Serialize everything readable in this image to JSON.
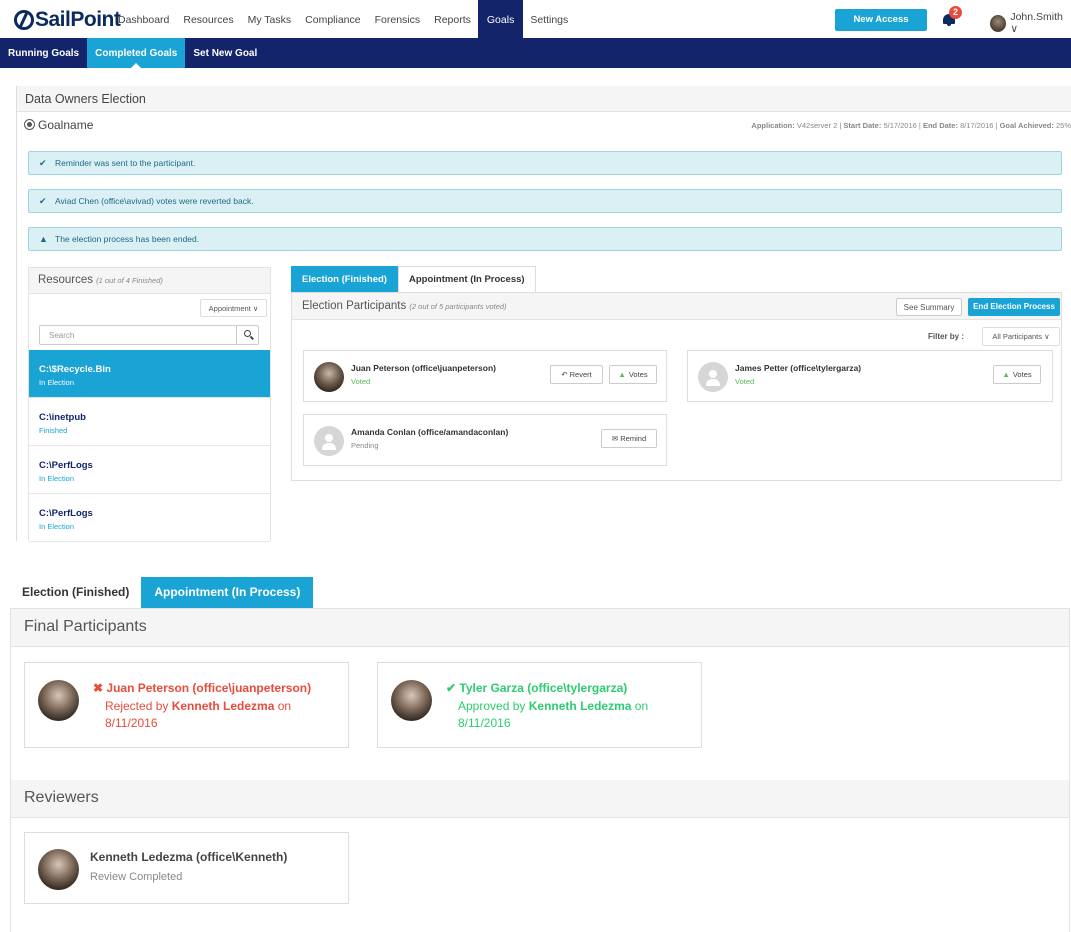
{
  "header": {
    "logo": "SailPoint",
    "nav": [
      "Dashboard",
      "Resources",
      "My Tasks",
      "Compliance",
      "Forensics",
      "Reports",
      "Goals",
      "Settings"
    ],
    "active_nav": "Goals",
    "new_request": "New Access Request",
    "notif_count": "2",
    "user": "John.Smith ∨"
  },
  "subnav": [
    "Running Goals",
    "Completed Goals",
    "Set New Goal"
  ],
  "page": {
    "title": "Data Owners Election",
    "goal_name": "Goalname",
    "meta": {
      "app_label": "Application:",
      "app": "V42server 2",
      "start_label": "Start Date:",
      "start": "5/17/2016",
      "end_label": "End Date:",
      "end": "8/17/2016",
      "achieved_label": "Goal Achieved:",
      "achieved": "25%"
    }
  },
  "alerts": [
    {
      "icon": "check-icon",
      "text": "Reminder was sent to the participant."
    },
    {
      "icon": "check-icon",
      "text": "Aviad Chen (office\\avivad) votes were reverted back."
    },
    {
      "icon": "warning-icon",
      "text": "The election process has been ended."
    }
  ],
  "resources": {
    "title": "Resources",
    "subtitle": "(1 out of 4 Finished)",
    "dropdown": "Appointment ∨",
    "search_placeholder": "Search",
    "items": [
      {
        "name": "C:\\$Recycle.Bin",
        "status": "In Election"
      },
      {
        "name": "C:\\inetpub",
        "status": "Finished"
      },
      {
        "name": "C:\\PerfLogs",
        "status": "In Election"
      },
      {
        "name": "C:\\PerfLogs",
        "status": "In Election"
      }
    ]
  },
  "election": {
    "tabs": [
      "Election (Finished)",
      "Appointment (In Process)"
    ],
    "title": "Election Participants",
    "subtitle": "(2 out of 5 participants voted)",
    "see_summary": "See Summary",
    "end_process": "End Election Process",
    "filter_label": "Filter by :",
    "filter_value": "All Participants ∨",
    "participants": [
      {
        "name": "Juan Peterson (office\\juanpeterson)",
        "status": "Voted",
        "btn1": "Revert",
        "btn2": "Votes"
      },
      {
        "name": "James Petter (office\\tylergarza)",
        "status": "Voted",
        "btn2": "Votes"
      },
      {
        "name": "Amanda Conlan (office/amandaconlan)",
        "status": "Pending",
        "btn1": "Remind"
      }
    ]
  },
  "appointment": {
    "tabs": [
      "Election (Finished)",
      "Appointment (In Process)"
    ],
    "final_title": "Final Participants",
    "final": [
      {
        "name": "Juan Peterson (office\\juanpeterson)",
        "action": "Rejected by",
        "by": "Kenneth Ledezma",
        "on": "on",
        "date": "8/11/2016",
        "mark": "✖"
      },
      {
        "name": "Tyler Garza (office\\tylergarza)",
        "action": "Approved by",
        "by": "Kenneth Ledezma",
        "on": "on",
        "date": "8/11/2016",
        "mark": "✔"
      }
    ],
    "reviewers_title": "Reviewers",
    "reviewer": {
      "name": "Kenneth Ledezma (office\\Kenneth)",
      "status": "Review Completed"
    }
  },
  "colors": {
    "navy": "#13246b",
    "accent": "#1aa3d5",
    "green": "#2ecc71",
    "red": "#e74c3c"
  }
}
